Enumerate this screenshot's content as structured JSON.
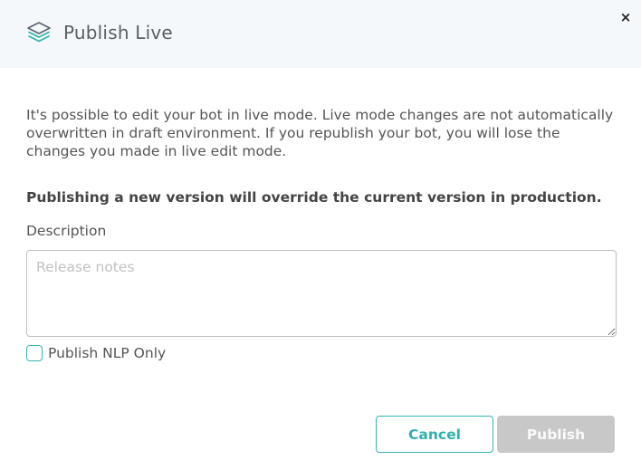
{
  "header": {
    "title": "Publish Live",
    "icon": "layers-icon",
    "accent_color": "#2fb1ac",
    "close_label": "×"
  },
  "body": {
    "info_text": "It's possible to edit your bot in live mode. Live mode changes are not automatically overwritten in draft environment. If you republish your bot, you will lose the changes you made in live edit mode.",
    "warning_text": "Publishing a new version will override the current version in production.",
    "description_label": "Description",
    "description_placeholder": "Release notes",
    "description_value": "",
    "checkbox_label": "Publish NLP Only",
    "checkbox_checked": false
  },
  "footer": {
    "cancel_label": "Cancel",
    "publish_label": "Publish",
    "publish_disabled": true
  }
}
